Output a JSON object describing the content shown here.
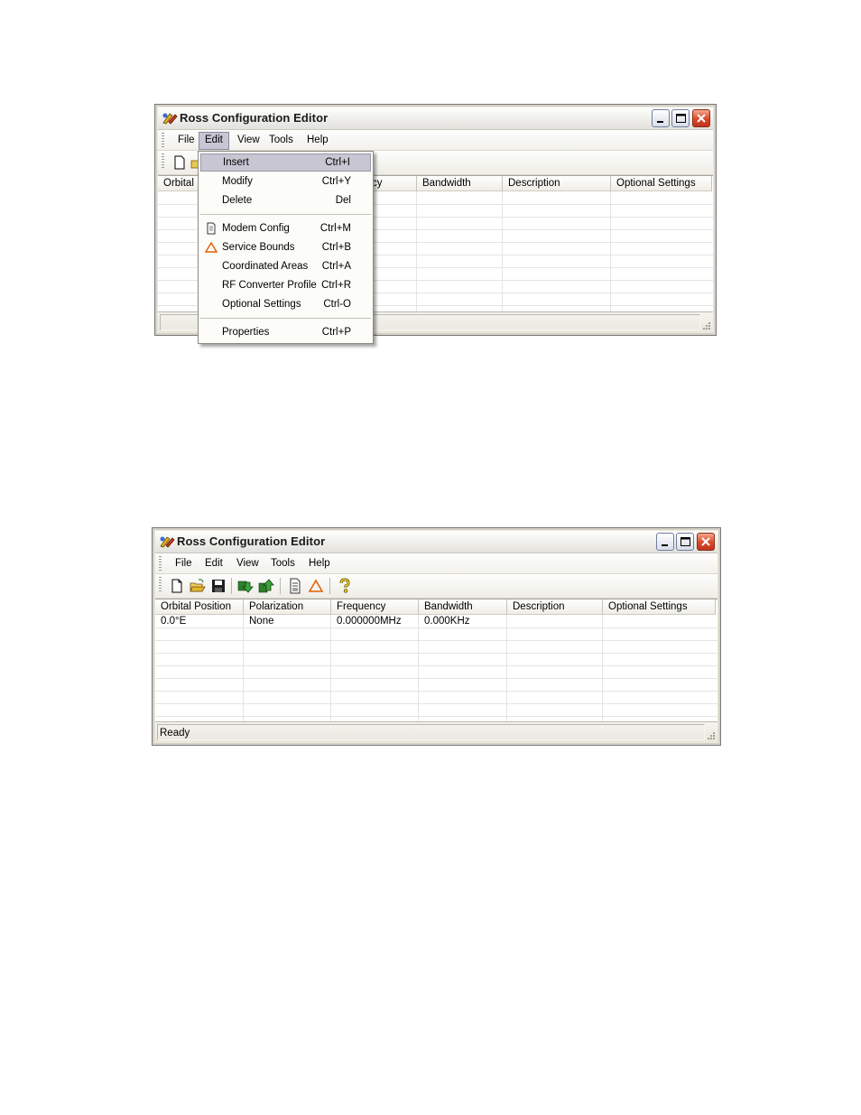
{
  "window1": {
    "title": "Ross Configuration Editor",
    "menu": [
      "File",
      "Edit",
      "View",
      "Tools",
      "Help"
    ],
    "columns": [
      "Orbital",
      "cy",
      "Bandwidth",
      "Description",
      "Optional Settings"
    ],
    "edit_menu": {
      "items": [
        {
          "label": "Insert",
          "shortcut": "Ctrl+I"
        },
        {
          "label": "Modify",
          "shortcut": "Ctrl+Y"
        },
        {
          "label": "Delete",
          "shortcut": "Del"
        },
        {
          "label": "Modem Config",
          "shortcut": "Ctrl+M"
        },
        {
          "label": "Service Bounds",
          "shortcut": "Ctrl+B"
        },
        {
          "label": "Coordinated Areas",
          "shortcut": "Ctrl+A"
        },
        {
          "label": "RF Converter Profile",
          "shortcut": "Ctrl+R"
        },
        {
          "label": "Optional Settings",
          "shortcut": "Ctrl-O"
        },
        {
          "label": "Properties",
          "shortcut": "Ctrl+P"
        }
      ]
    }
  },
  "window2": {
    "title": "Ross Configuration Editor",
    "menu": [
      "File",
      "Edit",
      "View",
      "Tools",
      "Help"
    ],
    "columns": [
      "Orbital Position",
      "Polarization",
      "Frequency",
      "Bandwidth",
      "Description",
      "Optional Settings"
    ],
    "rows": [
      [
        "0.0°E",
        "None",
        "0.000000MHz",
        "0.000KHz",
        "",
        ""
      ]
    ],
    "status": "Ready",
    "toolbar_icons": [
      "new-icon",
      "open-icon",
      "save-icon",
      "download-icon",
      "upload-icon",
      "document-icon",
      "warning-triangle-icon",
      "help-icon"
    ]
  },
  "colors": {
    "menu_highlight": "#c8c6d2",
    "close_button": "#d9492b",
    "warning": "#e65c00"
  }
}
